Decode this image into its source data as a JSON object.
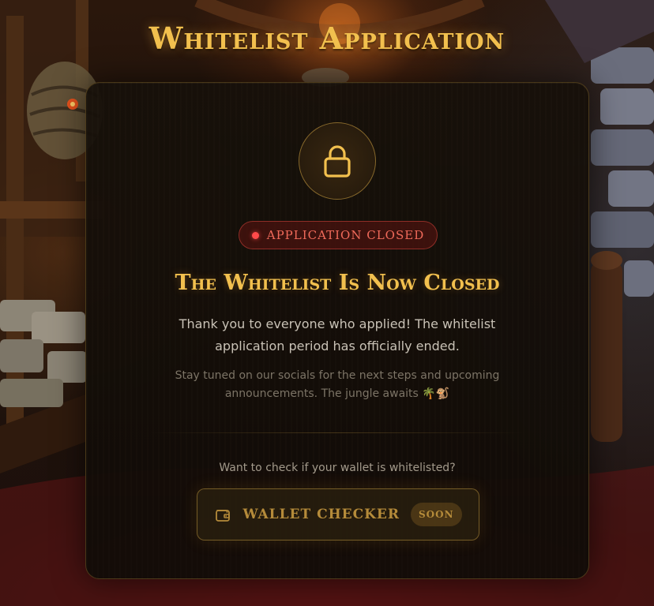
{
  "page": {
    "title": "Whitelist Application"
  },
  "card": {
    "lock_icon": "lock-icon",
    "status_badge": "APPLICATION CLOSED",
    "status_color": "#ff4a4a",
    "heading": "The Whitelist Is Now Closed",
    "message": "Thank you to everyone who applied! The whitelist application period has officially ended.",
    "note": "Stay tuned on our socials for the next steps and upcoming announcements. The jungle awaits 🌴🐒",
    "wallet_prompt": "Want to check if your wallet is whitelisted?",
    "wallet_button": {
      "icon": "wallet-icon",
      "label": "WALLET CHECKER",
      "badge": "SOON"
    }
  },
  "colors": {
    "gold": "#f2c04e",
    "muted_gold": "#b58b3a",
    "closed_red": "#f06a5a",
    "card_bg": "#16100a"
  }
}
